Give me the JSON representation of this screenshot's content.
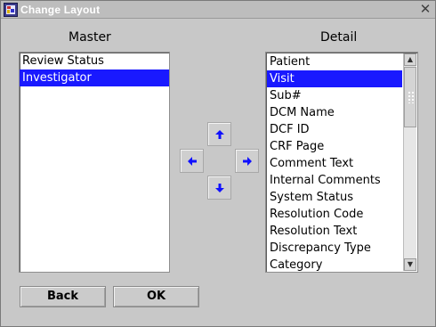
{
  "window": {
    "title": "Change Layout",
    "close_glyph": "✕"
  },
  "master": {
    "label": "Master",
    "items": [
      {
        "label": "Review Status",
        "selected": false
      },
      {
        "label": "Investigator",
        "selected": true
      }
    ]
  },
  "detail": {
    "label": "Detail",
    "items": [
      {
        "label": "Patient",
        "selected": false
      },
      {
        "label": "Visit",
        "selected": true
      },
      {
        "label": "Sub#",
        "selected": false
      },
      {
        "label": "DCM Name",
        "selected": false
      },
      {
        "label": "DCF ID",
        "selected": false
      },
      {
        "label": "CRF Page",
        "selected": false
      },
      {
        "label": "Comment Text",
        "selected": false
      },
      {
        "label": "Internal Comments",
        "selected": false
      },
      {
        "label": "System Status",
        "selected": false
      },
      {
        "label": "Resolution Code",
        "selected": false
      },
      {
        "label": "Resolution Text",
        "selected": false
      },
      {
        "label": "Discrepancy Type",
        "selected": false
      },
      {
        "label": "Category",
        "selected": false
      }
    ]
  },
  "move_controls": {
    "up_icon": "arrow-up-icon",
    "left_icon": "arrow-left-icon",
    "right_icon": "arrow-right-icon",
    "down_icon": "arrow-down-icon"
  },
  "buttons": {
    "back_label": "Back",
    "ok_label": "OK"
  },
  "colors": {
    "selection": "#1919ff",
    "arrow": "#1010ff",
    "window_bg": "#c8c8c8"
  }
}
